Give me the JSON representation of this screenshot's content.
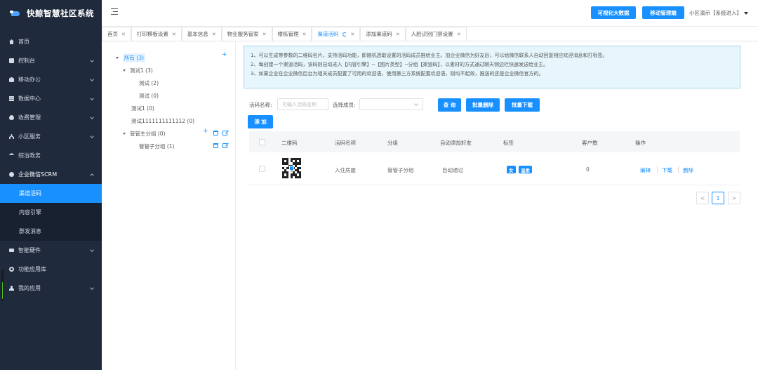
{
  "app": {
    "title": "快鲸智慧社区系统"
  },
  "sidebar": {
    "items": [
      {
        "label": "首页",
        "icon": "home-icon"
      },
      {
        "label": "控制台",
        "icon": "card-icon"
      },
      {
        "label": "移动办公",
        "icon": "briefcase-icon"
      },
      {
        "label": "数据中心",
        "icon": "database-icon"
      },
      {
        "label": "收费管理",
        "icon": "money-icon"
      },
      {
        "label": "小区服务",
        "icon": "service-icon"
      },
      {
        "label": "综治政务",
        "icon": "bank-icon"
      },
      {
        "label": "企业微信SCRM",
        "icon": "wechat-icon"
      },
      {
        "label": "智能硬件",
        "icon": "hardware-icon"
      },
      {
        "label": "功能应用库",
        "icon": "gear-icon"
      },
      {
        "label": "我的应用",
        "icon": "user-icon"
      }
    ],
    "subitems": [
      {
        "label": "渠道活码"
      },
      {
        "label": "内容引擎"
      },
      {
        "label": "群发消息"
      }
    ]
  },
  "header": {
    "bigdata_label": "可视化大数据",
    "mobile_label": "移动管理端",
    "user_label": "小区演示【系统进入】"
  },
  "tabs": [
    {
      "label": "首页"
    },
    {
      "label": "打印模板设置"
    },
    {
      "label": "基本信息"
    },
    {
      "label": "物业服务管家"
    },
    {
      "label": "楼栋管理"
    },
    {
      "label": "渠道活码"
    },
    {
      "label": "添加渠道码"
    },
    {
      "label": "人脸识别门禁设置"
    }
  ],
  "tree": {
    "all": "所有 (3)",
    "n1": "测试1 (3)",
    "n1a": "测试 (2)",
    "n1b": "测试 (0)",
    "n2": "测试1 (0)",
    "n3": "测试1111111111112 (0)",
    "n4": "管管主分组 (0)",
    "n4a": "管管子分组 (1)"
  },
  "notice": {
    "line1": "1、可以生成带参数的二维码名片，支持活码功能，即随机选取设置的活码成员推给业主。加企业微信为好友后，可以给微信联系人自动回复相应欢迎消息和打标签。",
    "line2": "2、每创建一个渠道活码，该码则自动进入【内容引擎】--【图片类型】--分组【渠道码】，以素材的方式通过聊天侧边栏快速发送给业主。",
    "line3": "3、如果企业在企业微信后台为相关成员配置了可用的欢迎语，使用第三方系统配置欢迎语，则均不起效，推送的还是企业微信官方的。"
  },
  "filter": {
    "name_label": "活码名称:",
    "name_placeholder": "可输入活码名称",
    "member_label": "选择成员:",
    "query_label": "查 询",
    "batch_delete_label": "批量删除",
    "batch_download_label": "批量下载",
    "add_label": "添 加"
  },
  "table": {
    "columns": [
      "二维码",
      "活码名称",
      "分组",
      "自动添加好友",
      "标签",
      "客户数",
      "操作"
    ],
    "rows": [
      {
        "name": "入住房屋",
        "group": "管管子分组",
        "auto_add": "自动通过",
        "tags": [
          "女",
          "温柔"
        ],
        "customers": "0",
        "actions": [
          "编辑",
          "下载",
          "删除"
        ]
      }
    ]
  },
  "pagination": {
    "prev": "<",
    "current": "1",
    "next": ">"
  },
  "colors": {
    "accent": "#1890ff",
    "sidebar": "#1f2a3d",
    "notice_bg": "#e6f6fc"
  }
}
